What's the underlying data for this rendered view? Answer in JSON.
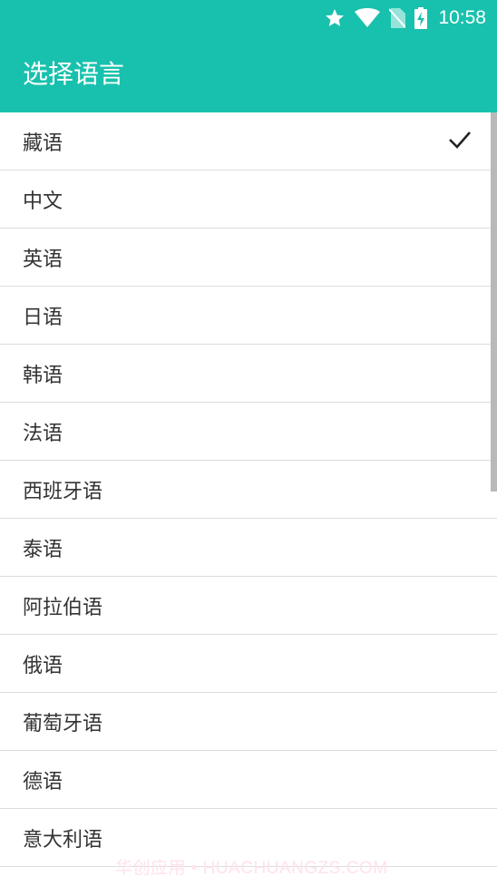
{
  "status_bar": {
    "time": "10:58",
    "icons": [
      "star-icon",
      "wifi-icon",
      "no-sim-icon",
      "battery-charging-icon"
    ]
  },
  "app_bar": {
    "title": "选择语言"
  },
  "languages": [
    {
      "label": "藏语",
      "selected": true
    },
    {
      "label": "中文"
    },
    {
      "label": "英语"
    },
    {
      "label": "日语"
    },
    {
      "label": "韩语"
    },
    {
      "label": "法语"
    },
    {
      "label": "西班牙语"
    },
    {
      "label": "泰语"
    },
    {
      "label": "阿拉伯语"
    },
    {
      "label": "俄语"
    },
    {
      "label": "葡萄牙语"
    },
    {
      "label": "德语"
    },
    {
      "label": "意大利语"
    }
  ],
  "watermark": "华创应用 • HUACHUANGZS.COM",
  "colors": {
    "accent": "#18c1ad",
    "divider": "#dcdcdc",
    "text": "#333333"
  }
}
